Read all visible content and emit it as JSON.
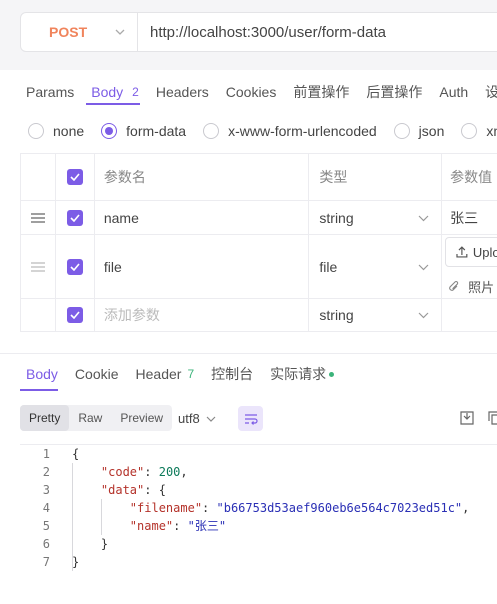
{
  "request": {
    "method": "POST",
    "url": "http://localhost:3000/user/form-data"
  },
  "request_tabs": [
    {
      "label": "Params"
    },
    {
      "label": "Body",
      "count": "2"
    },
    {
      "label": "Headers"
    },
    {
      "label": "Cookies"
    },
    {
      "label": "前置操作"
    },
    {
      "label": "后置操作"
    },
    {
      "label": "Auth"
    },
    {
      "label": "设置"
    }
  ],
  "body_types": [
    "none",
    "form-data",
    "x-www-form-urlencoded",
    "json",
    "xml"
  ],
  "body_selected": "form-data",
  "params_table": {
    "headers": {
      "name": "参数名",
      "type": "类型",
      "value": "参数值"
    },
    "rows": [
      {
        "name": "name",
        "type": "string",
        "value": "张三"
      },
      {
        "name": "file",
        "type": "file",
        "upload_label": "Upload",
        "file_name": "照片"
      }
    ],
    "add_placeholder": "添加参数",
    "add_type": "string"
  },
  "response_tabs": [
    {
      "label": "Body"
    },
    {
      "label": "Cookie"
    },
    {
      "label": "Header",
      "count": "7"
    },
    {
      "label": "控制台"
    },
    {
      "label": "实际请求"
    }
  ],
  "response_format": {
    "modes": [
      "Pretty",
      "Raw",
      "Preview"
    ],
    "selected": "Pretty",
    "encoding": "utf8"
  },
  "response_body": {
    "line_numbers": [
      "1",
      "2",
      "3",
      "4",
      "5",
      "6",
      "7"
    ],
    "code": "200",
    "filename": "b66753d53aef960eb6e564c7023ed51c",
    "name": "张三"
  },
  "colors": {
    "accent": "#7c5ce6",
    "method": "#f0845c",
    "green": "#3bb37a"
  }
}
